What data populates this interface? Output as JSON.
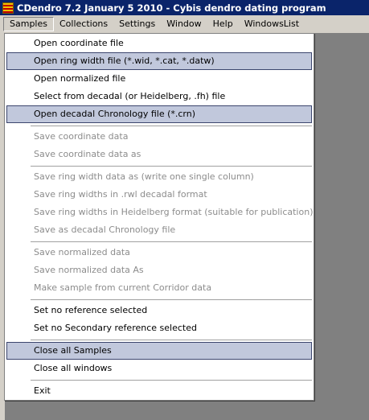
{
  "window": {
    "title": "CDendro 7.2  January 5 2010 - Cybis dendro dating program"
  },
  "menubar": {
    "items": [
      "Samples",
      "Collections",
      "Settings",
      "Window",
      "Help",
      "WindowsList"
    ]
  },
  "samples_menu": {
    "items": [
      {
        "label": "Open coordinate file",
        "enabled": true,
        "highlighted": false
      },
      {
        "label": "Open ring width file (*.wid, *.cat, *.datw)",
        "enabled": true,
        "highlighted": true
      },
      {
        "label": "Open normalized file",
        "enabled": true,
        "highlighted": false
      },
      {
        "label": "Select from decadal (or Heidelberg, .fh) file",
        "enabled": true,
        "highlighted": false
      },
      {
        "label": "Open decadal Chronology file (*.crn)",
        "enabled": true,
        "highlighted": true
      },
      {
        "label": "Save coordinate data",
        "enabled": false,
        "highlighted": false
      },
      {
        "label": "Save coordinate data as",
        "enabled": false,
        "highlighted": false
      },
      {
        "label": "Save ring width data as  (write one single column)",
        "enabled": false,
        "highlighted": false
      },
      {
        "label": "Save ring widths in .rwl decadal format",
        "enabled": false,
        "highlighted": false
      },
      {
        "label": "Save ring widths in Heidelberg format (suitable for publication)",
        "enabled": false,
        "highlighted": false
      },
      {
        "label": "Save as decadal Chronology file",
        "enabled": false,
        "highlighted": false
      },
      {
        "label": "Save normalized data",
        "enabled": false,
        "highlighted": false
      },
      {
        "label": "Save normalized data As",
        "enabled": false,
        "highlighted": false
      },
      {
        "label": "Make sample from current Corridor data",
        "enabled": false,
        "highlighted": false
      },
      {
        "label": "Set no reference selected",
        "enabled": true,
        "highlighted": false
      },
      {
        "label": "Set no Secondary reference selected",
        "enabled": true,
        "highlighted": false
      },
      {
        "label": "Close all Samples",
        "enabled": true,
        "highlighted": true
      },
      {
        "label": "Close all windows",
        "enabled": true,
        "highlighted": false
      },
      {
        "label": "Exit",
        "enabled": true,
        "highlighted": false
      }
    ]
  },
  "colors": {
    "titlebar": "#0a246a",
    "highlight_fill": "#c1c8dc",
    "highlight_border": "#3c466e",
    "disabled_text": "#8c8c8c",
    "workspace": "#808080"
  }
}
